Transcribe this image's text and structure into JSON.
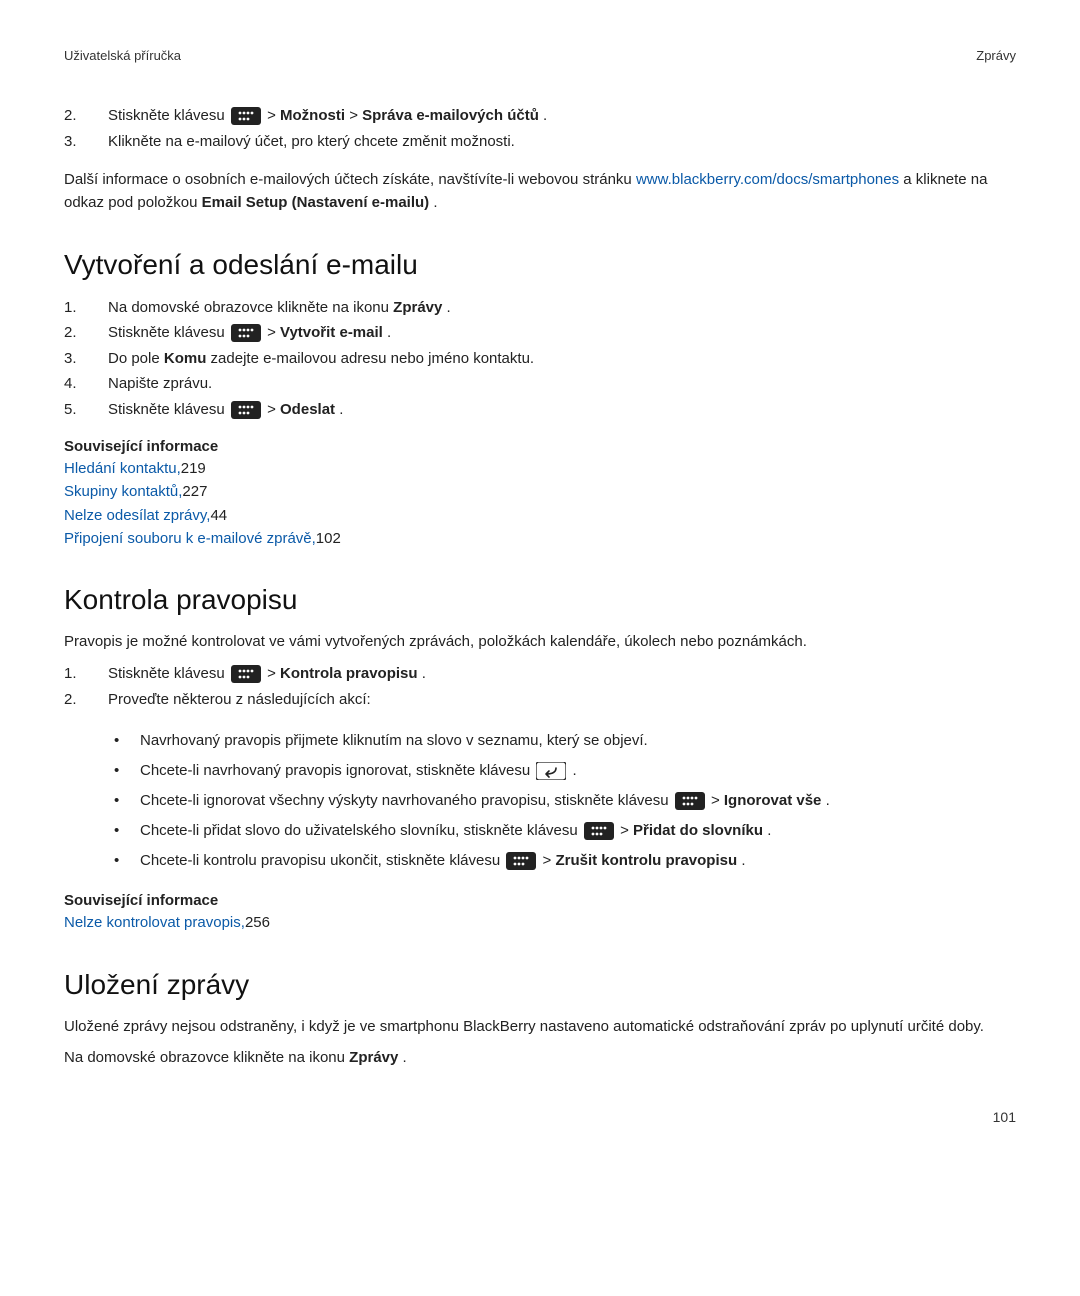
{
  "header": {
    "left": "Uživatelská příručka",
    "right": "Zprávy"
  },
  "top_steps": [
    {
      "num": "2.",
      "pre": "Stiskněte klávesu ",
      "icon": "menu",
      "sep": "  > ",
      "bold1": "Možnosti",
      "mid": " > ",
      "bold2": "Správa e-mailových účtů",
      "tail": "."
    },
    {
      "num": "3.",
      "text": "Klikněte na e-mailový účet, pro který chcete změnit možnosti."
    }
  ],
  "intro_para": {
    "pre": "Další informace o osobních e-mailových účtech získáte, navštívíte-li webovou stránku ",
    "link": "www.blackberry.com/docs/smartphones",
    "mid": " a kliknete na odkaz pod položkou ",
    "bold": "Email Setup (Nastavení e-mailu)",
    "tail": "."
  },
  "section1": {
    "title": "Vytvoření a odeslání e-mailu",
    "steps": [
      {
        "num": "1.",
        "pre": "Na domovské obrazovce klikněte na ikonu ",
        "bold": "Zprávy",
        "tail": "."
      },
      {
        "num": "2.",
        "pre": "Stiskněte klávesu ",
        "icon": "menu",
        "sep": "  > ",
        "bold": "Vytvořit e-mail",
        "tail": "."
      },
      {
        "num": "3.",
        "pre": "Do pole ",
        "bold": "Komu",
        "tail": " zadejte e-mailovou adresu nebo jméno kontaktu."
      },
      {
        "num": "4.",
        "text": "Napište zprávu."
      },
      {
        "num": "5.",
        "pre": "Stiskněte klávesu ",
        "icon": "menu",
        "sep": "  > ",
        "bold": "Odeslat",
        "tail": "."
      }
    ],
    "related_heading": "Související informace",
    "related": [
      {
        "link": "Hledání kontaktu,",
        "page": "219"
      },
      {
        "link": "Skupiny kontaktů,",
        "page": "227"
      },
      {
        "link": "Nelze odesílat zprávy,",
        "page": "44"
      },
      {
        "link": "Připojení souboru k e-mailové zprávě,",
        "page": "102"
      }
    ]
  },
  "section2": {
    "title": "Kontrola pravopisu",
    "intro": "Pravopis je možné kontrolovat ve vámi vytvořených zprávách, položkách kalendáře, úkolech nebo poznámkách.",
    "steps": [
      {
        "num": "1.",
        "pre": "Stiskněte klávesu ",
        "icon": "menu",
        "sep": "  > ",
        "bold": "Kontrola pravopisu",
        "tail": "."
      },
      {
        "num": "2.",
        "text": "Proveďte některou z následujících akcí:"
      }
    ],
    "bullets": [
      {
        "text": "Navrhovaný pravopis přijmete kliknutím na slovo v seznamu, který se objeví."
      },
      {
        "pre": "Chcete-li navrhovaný pravopis ignorovat, stiskněte klávesu ",
        "icon": "back",
        "tail": " ."
      },
      {
        "pre": "Chcete-li ignorovat všechny výskyty navrhovaného pravopisu, stiskněte klávesu ",
        "icon": "menu",
        "sep": "  > ",
        "bold": "Ignorovat vše",
        "tail": "."
      },
      {
        "pre": "Chcete-li přidat slovo do uživatelského slovníku, stiskněte klávesu ",
        "icon": "menu",
        "sep": "  > ",
        "bold": "Přidat do slovníku",
        "tail": "."
      },
      {
        "pre": "Chcete-li kontrolu pravopisu ukončit, stiskněte klávesu ",
        "icon": "menu",
        "sep": "  > ",
        "bold": "Zrušit kontrolu pravopisu",
        "tail": "."
      }
    ],
    "related_heading": "Související informace",
    "related": [
      {
        "link": "Nelze kontrolovat pravopis,",
        "page": "256"
      }
    ]
  },
  "section3": {
    "title": "Uložení zprávy",
    "para": "Uložené zprávy nejsou odstraněny, i když je ve smartphonu BlackBerry nastaveno automatické odstraňování zpráv po uplynutí určité doby.",
    "line_pre": "Na domovské obrazovce klikněte na ikonu ",
    "line_bold": "Zprávy",
    "line_tail": "."
  },
  "page_number": "101",
  "icons": {
    "menu": "menu-key-icon",
    "back": "back-key-icon"
  }
}
